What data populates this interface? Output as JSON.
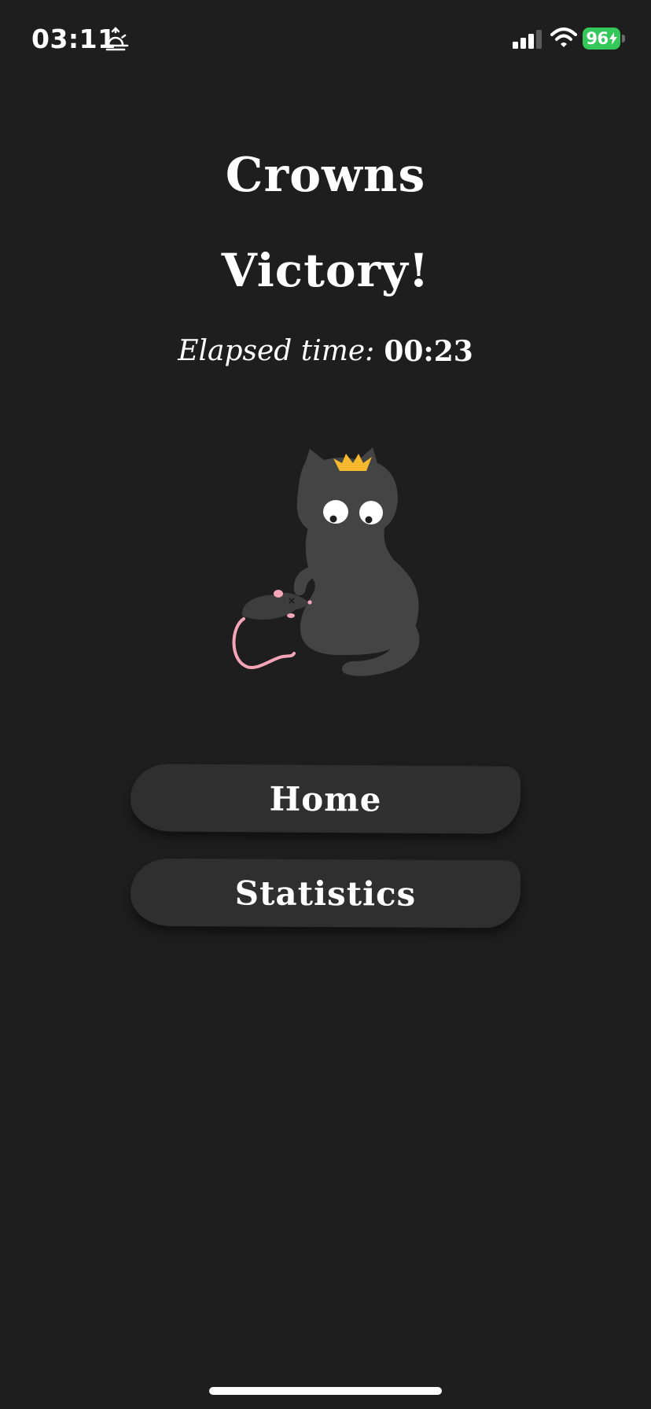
{
  "status_bar": {
    "time": "03:11",
    "battery_level": "96",
    "icons": [
      "sunrise-icon",
      "signal-icon",
      "wifi-icon",
      "battery-charging-icon"
    ]
  },
  "header": {
    "app_title": "Crowns",
    "result_title": "Victory!"
  },
  "elapsed": {
    "label": "Elapsed time:",
    "value": "00:23"
  },
  "illustration": {
    "icons": [
      "crowned-cat-icon",
      "crown-icon",
      "mouse-icon"
    ],
    "colors": {
      "cat": "#444444",
      "crown": "#f5b82e",
      "mouse": "#3d3d3d",
      "mouse_tail": "#f4a6b8"
    }
  },
  "actions": {
    "home_label": "Home",
    "statistics_label": "Statistics"
  },
  "colors": {
    "background": "#1e1e1e",
    "button": "#2f2f2f",
    "text": "#ffffff",
    "battery": "#34c759"
  }
}
